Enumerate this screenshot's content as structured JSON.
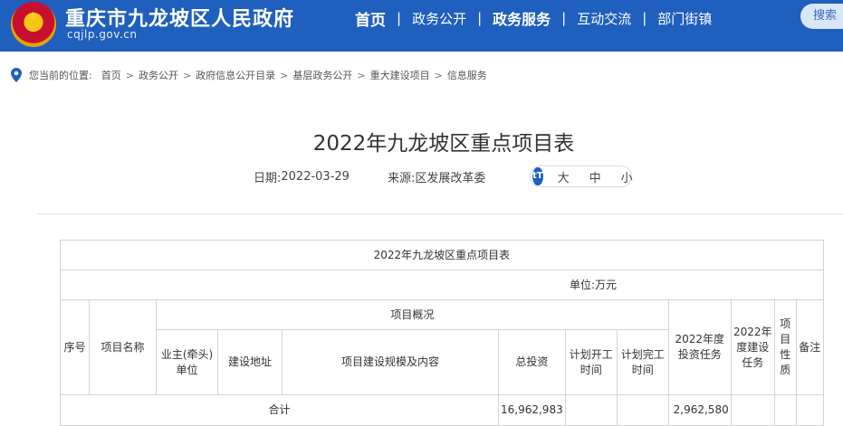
{
  "header": {
    "site_name": "重庆市九龙坡区人民政府",
    "domain": "cqjlp.gov.cn",
    "nav": [
      "首页",
      "政务公开",
      "政务服务",
      "互动交流",
      "部门街镇"
    ],
    "search_label": "搜索",
    "brand_color": "#1f5fbd"
  },
  "breadcrumb": {
    "prefix": "您当前的位置:",
    "items": [
      "首页",
      "政务公开",
      "政府信息公开目录",
      "基层政务公开",
      "重大建设项目",
      "信息服务"
    ],
    "separator": ">"
  },
  "article": {
    "title": "2022年九龙坡区重点项目表",
    "date_label": "日期:",
    "date": "2022-03-29",
    "source_label": "来源:",
    "source": "区发展改革委",
    "font_size_options": [
      "大",
      "中",
      "小"
    ]
  },
  "table": {
    "caption": "2022年九龙坡区重点项目表",
    "unit": "单位:万元",
    "headers": {
      "seq": "序号",
      "name": "项目名称",
      "overview": "项目概况",
      "owner": "业主(牵头)单位",
      "location": "建设地址",
      "scale": "项目建设规模及内容",
      "total": "总投资",
      "plan_start": "计划开工时间",
      "plan_end": "计划完工时间",
      "invest_2022": "2022年度投资任务",
      "build_2022": "2022年度建设任务",
      "nature": "项目性质",
      "remark": "备注"
    },
    "total_row": {
      "label": "合计",
      "total_investment": "16,962,983",
      "investment_2022": "2,962,580"
    }
  }
}
